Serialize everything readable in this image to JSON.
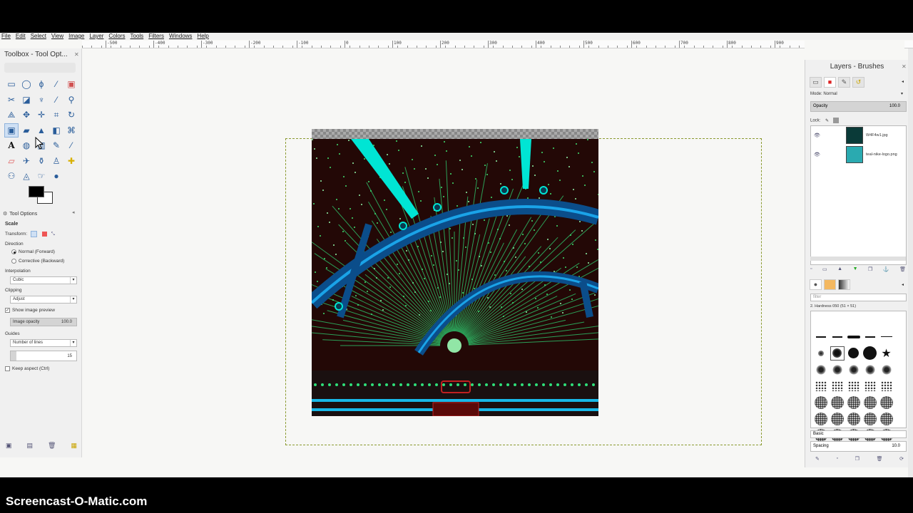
{
  "menu": [
    "File",
    "Edit",
    "Select",
    "View",
    "Image",
    "Layer",
    "Colors",
    "Tools",
    "Filters",
    "Windows",
    "Help"
  ],
  "ruler": {
    "labels": [
      "-500",
      "-400",
      "-300",
      "-200",
      "-100",
      "0",
      "100",
      "200",
      "300",
      "400",
      "500",
      "600",
      "700",
      "800",
      "900",
      "1000",
      "1100",
      "1200",
      "1300"
    ]
  },
  "toolbox": {
    "title": "Toolbox - Tool Opt...",
    "tools": [
      "rect-select",
      "ellipse-select",
      "free-select",
      "fuzzy-select",
      "color-select",
      "scissors-select",
      "foreground-select",
      "paths",
      "color-picker",
      "zoom",
      "measure",
      "move",
      "align",
      "crop",
      "rotate",
      "scale",
      "shear",
      "perspective",
      "flip",
      "cage-transform",
      "text",
      "bucket-fill",
      "blend",
      "pencil",
      "paintbrush",
      "eraser",
      "airbrush",
      "ink",
      "clone",
      "heal",
      "perspective-clone",
      "blur",
      "smudge",
      "dodge-burn"
    ],
    "selected_tool_index": 15,
    "tool_options_tab": "Tool Options",
    "tool_name": "Scale",
    "transform_label": "Transform:",
    "direction_label": "Direction",
    "direction_normal": "Normal (Forward)",
    "direction_corrective": "Corrective (Backward)",
    "interpolation_label": "Interpolation",
    "interpolation_value": "Cubic",
    "clipping_label": "Clipping",
    "clipping_value": "Adjust",
    "show_preview_label": "Show image preview",
    "image_opacity_label": "Image opacity",
    "image_opacity_value": "100.0",
    "guides_label": "Guides",
    "guides_value": "Number of lines",
    "lines_value": "15",
    "keep_aspect_label": "Keep aspect  (Ctrl)"
  },
  "right_dock": {
    "title": "Layers - Brushes",
    "mode_label": "Mode: Normal",
    "opacity_label": "Opacity",
    "opacity_value": "100.0",
    "lock_label": "Lock:",
    "layers": [
      {
        "name": "W4F4w1.jpg",
        "thumb_color": "#0a3a38"
      },
      {
        "name": "teal-nike-logo.png",
        "thumb_color": "#2aaab0"
      }
    ],
    "filter_placeholder": "filter",
    "brush_info": "2. Hardness 050 (51 × 51)",
    "brush_tag": "Basic",
    "spacing_label": "Spacing",
    "spacing_value": "10.0"
  },
  "watermark": "Screencast-O-Matic.com",
  "colors": {
    "accent": "#00e5d4",
    "canvas_bg": "#f7f7f5",
    "panel_bg": "#f0f0f0"
  }
}
